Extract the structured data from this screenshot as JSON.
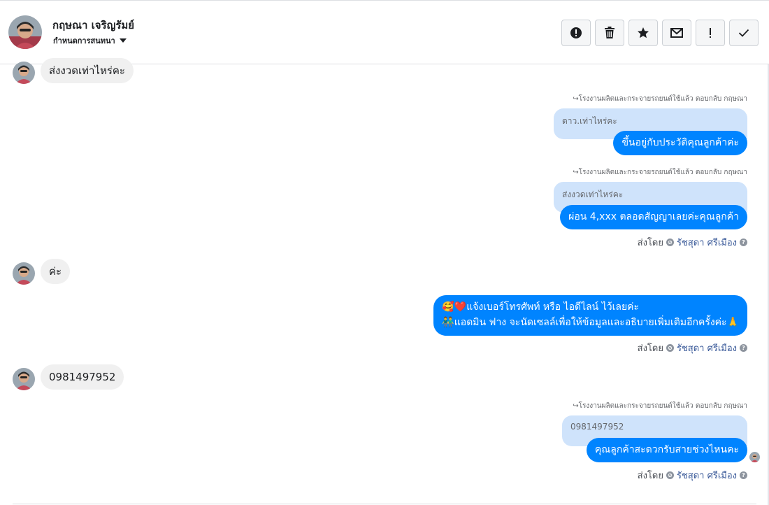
{
  "header": {
    "contact_name": "กฤษณา เจริญรัมย์",
    "assign_label": "กำหนดการสนทนา",
    "actions": [
      {
        "name": "report-spam-button",
        "icon": "alert-circle-icon"
      },
      {
        "name": "delete-button",
        "icon": "trash-icon"
      },
      {
        "name": "star-button",
        "icon": "star-icon"
      },
      {
        "name": "mark-unread-button",
        "icon": "envelope-icon"
      },
      {
        "name": "important-button",
        "icon": "exclamation-icon"
      },
      {
        "name": "mark-done-button",
        "icon": "check-icon"
      }
    ]
  },
  "messages": {
    "m1_text": "ส่งงวดเท่าไหร่คะ",
    "m2_reply_note": "โรงงานผลิตและกระจายรถยนต์ใช้แล้ว ตอบกลับ กฤษณา",
    "m2_quote": "ดาว.เท่าไหร่คะ",
    "m2_text": "ขึ้นอยู่กับประวัติคุณลูกค้าค่ะ",
    "m3_reply_note": "โรงงานผลิตและกระจายรถยนต์ใช้แล้ว ตอบกลับ กฤษณา",
    "m3_quote": "ส่งงวดเท่าไหร่คะ",
    "m3_text": "ผ่อน 4,xxx ตลอดสัญญาเลยค่ะคุณลูกค้า",
    "m4_text": "ค่ะ",
    "m5_line1": "🥰❤️แจ้งเบอร์โทรศัพท์ หรือ ไอดีไลน์  ไว้เลยค่ะ",
    "m5_line2": "👬แอดมิน ฟาง จะนัดเซลล์เพื่อให้ข้อมูลและอธิบายเพิ่มเติมอีกครั้งค่ะ🙏",
    "m6_text": "0981497952",
    "m7_reply_note": "โรงงานผลิตและกระจายรถยนต์ใช้แล้ว ตอบกลับ กฤษณา",
    "m7_quote": "0981497952",
    "m7_text": "คุณลูกค้าสะดวกรับสายช่วงไหนคะ"
  },
  "sent_by": {
    "label": "ส่งโดย",
    "agent": "รัชสุดา ศรีเมือง"
  },
  "colors": {
    "outgoing_bubble": "#0084ff",
    "incoming_bubble": "#f0f0f0",
    "quote_bubble": "#cfe3fb"
  }
}
